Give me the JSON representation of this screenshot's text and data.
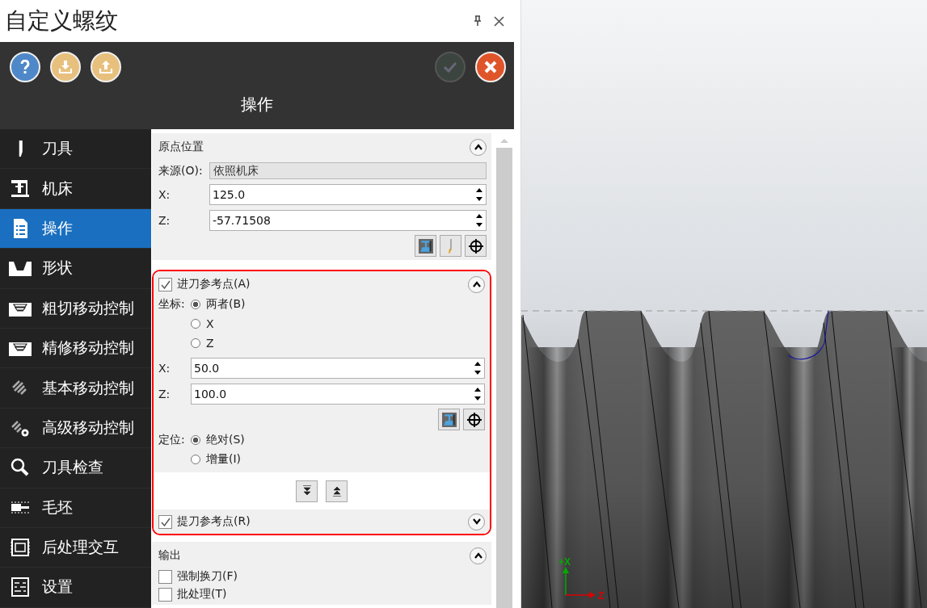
{
  "window": {
    "title": "自定义螺纹"
  },
  "toolbar": {
    "title": "操作",
    "actions": [
      {
        "kind": "help",
        "disabled": false
      },
      {
        "kind": "import",
        "disabled": false
      },
      {
        "kind": "export",
        "disabled": false
      },
      {
        "kind": "ok",
        "disabled": true
      },
      {
        "kind": "cancel",
        "disabled": false
      }
    ]
  },
  "sidebar": {
    "items": [
      {
        "label": "刀具",
        "selected": false
      },
      {
        "label": "机床",
        "selected": false
      },
      {
        "label": "操作",
        "selected": true
      },
      {
        "label": "形状",
        "selected": false
      },
      {
        "label": "粗切移动控制",
        "selected": false
      },
      {
        "label": "精修移动控制",
        "selected": false
      },
      {
        "label": "基本移动控制",
        "selected": false
      },
      {
        "label": "高级移动控制",
        "selected": false
      },
      {
        "label": "刀具检查",
        "selected": false
      },
      {
        "label": "毛坯",
        "selected": false
      },
      {
        "label": "后处理交互",
        "selected": false
      },
      {
        "label": "设置",
        "selected": false
      }
    ]
  },
  "origin": {
    "title": "原点位置",
    "expanded": true,
    "source_label": "来源(O):",
    "source_value": "依照机床",
    "fields": [
      {
        "label": "X:",
        "value": "125.0"
      },
      {
        "label": "Z:",
        "value": "-57.71508"
      }
    ],
    "tool_buttons": [
      {
        "kind": "machine"
      },
      {
        "kind": "tool"
      },
      {
        "kind": "target"
      }
    ]
  },
  "reference_points": {
    "highlighted": true,
    "approach": {
      "title": "进刀参考点(A)",
      "checked": true,
      "expanded": true,
      "coord_label": "坐标:",
      "coord_options": [
        {
          "label": "两者(B)",
          "selected": true
        },
        {
          "label": "X",
          "selected": false
        },
        {
          "label": "Z",
          "selected": false
        }
      ],
      "fields": [
        {
          "label": "X:",
          "value": "50.0"
        },
        {
          "label": "Z:",
          "value": "100.0"
        }
      ],
      "tool_buttons": [
        {
          "kind": "machine"
        },
        {
          "kind": "target"
        }
      ],
      "position_label": "定位:",
      "position_options": [
        {
          "label": "绝对(S)",
          "selected": true
        },
        {
          "label": "增量(I)",
          "selected": false
        }
      ]
    },
    "nav_buttons": [
      {
        "kind": "down"
      },
      {
        "kind": "up"
      }
    ],
    "retract": {
      "title": "提刀参考点(R)",
      "checked": true,
      "expanded": false
    }
  },
  "output": {
    "title": "输出",
    "expanded": true,
    "options": [
      {
        "label": "强制换刀(F)",
        "checked": false
      },
      {
        "label": "批处理(T)",
        "checked": false
      }
    ]
  },
  "viewport": {
    "axis_labels": [
      {
        "kind": "x",
        "text": "+X"
      },
      {
        "kind": "z",
        "text": "Z"
      }
    ]
  }
}
